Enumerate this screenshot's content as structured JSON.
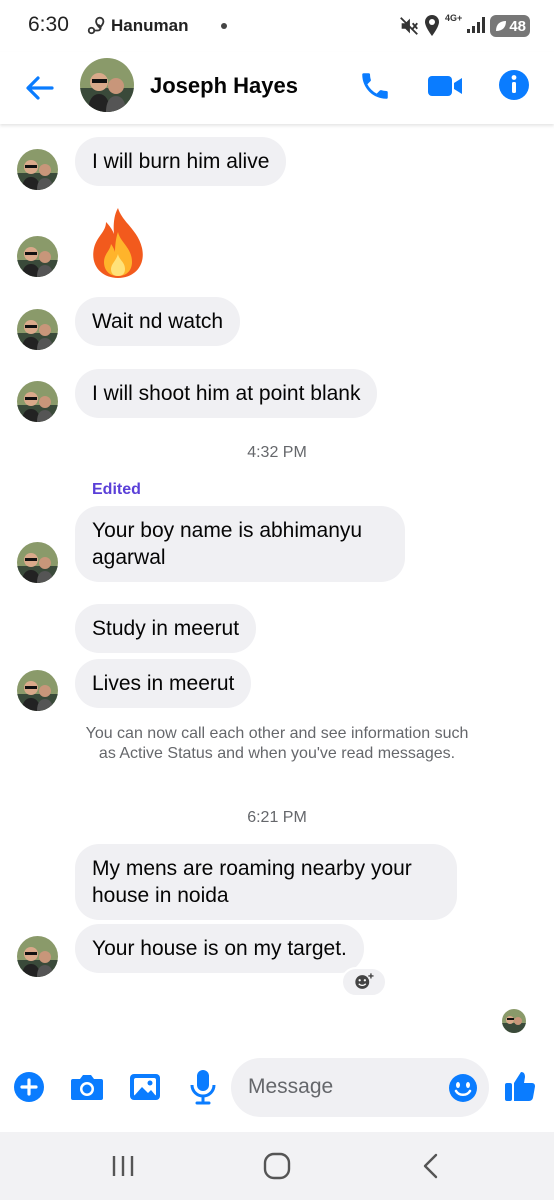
{
  "status_bar": {
    "time": "6:30",
    "carrier": "Hanuman T",
    "network": "4G+",
    "battery": "48",
    "icons": [
      "route-icon",
      "mute-icon",
      "location-icon",
      "signal-icon",
      "battery-icon"
    ]
  },
  "header": {
    "contact_name": "Joseph Hayes",
    "icons": [
      "back-arrow-icon",
      "phone-icon",
      "video-camera-icon",
      "info-icon"
    ],
    "accent_color": "#0a7cff"
  },
  "messages": [
    {
      "text": "I will burn him alive"
    },
    {
      "emoji": "fire-emoji"
    },
    {
      "text": "Wait nd watch"
    },
    {
      "text": "I will shoot him at point blank"
    }
  ],
  "timestamp_1": "4:32 PM",
  "edited_label": "Edited",
  "messages_2": [
    {
      "text": "Your boy name is abhimanyu agarwal"
    },
    {
      "text": "Study in meerut"
    },
    {
      "text": "Lives in meerut"
    }
  ],
  "notice": "You can now call each other and see information such as Active Status and when you've read messages.",
  "timestamp_2": "6:21 PM",
  "messages_3": [
    {
      "text": "My mens are roaming nearby your house in noida"
    },
    {
      "text": "Your house is on my target."
    }
  ],
  "composer": {
    "placeholder": "Message",
    "icons": [
      "plus-icon",
      "camera-icon",
      "image-icon",
      "microphone-icon",
      "emoji-icon",
      "thumbs-up-icon"
    ]
  },
  "navbar": {
    "icons": [
      "recents-icon",
      "home-icon",
      "back-icon"
    ]
  }
}
